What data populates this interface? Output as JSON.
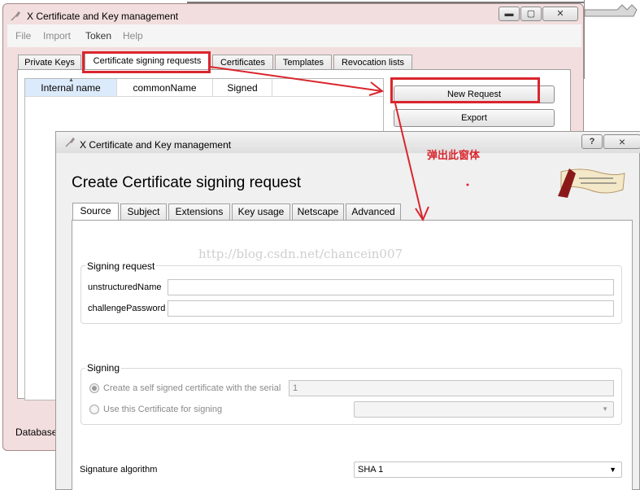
{
  "background_window": {
    "title": "X Certificate and Key management",
    "menu": [
      "File",
      "Import",
      "Token",
      "Help"
    ],
    "tabs": [
      "Private Keys",
      "Certificate signing requests",
      "Certificates",
      "Templates",
      "Revocation lists"
    ],
    "columns": [
      "Internal name",
      "commonName",
      "Signed"
    ],
    "buttons": {
      "new_request": "New Request",
      "export": "Export"
    },
    "database_label": "Database:"
  },
  "annotation": {
    "text": "弹出此窗体",
    "color": "#d9262e"
  },
  "watermark": "http://blog.csdn.net/chancein007",
  "dialog": {
    "title": "X Certificate and Key management",
    "help_button": "?",
    "close_button": "×",
    "heading": "Create Certificate signing request",
    "tabs": [
      "Source",
      "Subject",
      "Extensions",
      "Key usage",
      "Netscape",
      "Advanced"
    ],
    "signing_request": {
      "group_label": "Signing request",
      "unstructured_name_label": "unstructuredName",
      "unstructured_name_value": "",
      "challenge_password_label": "challengePassword",
      "challenge_password_value": ""
    },
    "signing": {
      "group_label": "Signing",
      "self_signed_label": "Create a self signed certificate with the serial",
      "serial_value": "1",
      "use_cert_label": "Use this Certificate for signing",
      "use_cert_value": ""
    },
    "signature_algorithm_label": "Signature algorithm",
    "signature_algorithm_value": "SHA 1"
  },
  "colors": {
    "accent_red": "#d9262e",
    "selection": "#dcebfb"
  }
}
